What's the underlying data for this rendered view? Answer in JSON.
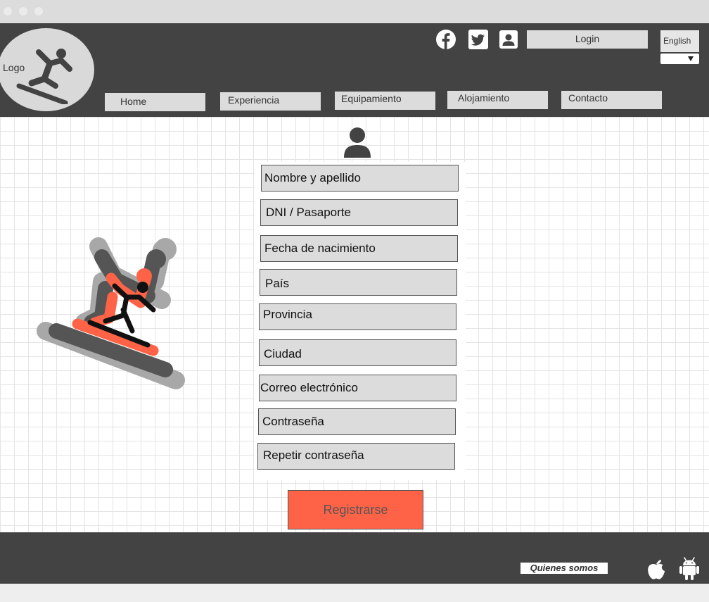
{
  "header": {
    "logo_label": "Logo",
    "login_label": "Login",
    "language": {
      "selected": "English"
    },
    "social_icons": [
      "facebook-icon",
      "twitter-icon",
      "contact-icon"
    ]
  },
  "nav": {
    "items": [
      {
        "label": "Home"
      },
      {
        "label": "Experiencia"
      },
      {
        "label": "Equipamiento"
      },
      {
        "label": "Alojamiento"
      },
      {
        "label": "Contacto"
      }
    ]
  },
  "form": {
    "icon": "user-icon",
    "fields": [
      {
        "placeholder": "Nombre y apellido"
      },
      {
        "placeholder": "DNI / Pasaporte"
      },
      {
        "placeholder": "Fecha de nacimiento"
      },
      {
        "placeholder": "País"
      },
      {
        "placeholder": "Provincia"
      },
      {
        "placeholder": "Ciudad"
      },
      {
        "placeholder": "Correo electrónico"
      },
      {
        "placeholder": "Contraseña"
      },
      {
        "placeholder": "Repetir contraseña"
      }
    ],
    "submit_label": "Registrarse"
  },
  "footer": {
    "about_label": "Quienes somos",
    "app_icons": [
      "apple-icon",
      "android-icon"
    ]
  },
  "colors": {
    "header_bg": "#434343",
    "accent": "#ff6347",
    "field_bg": "#dcdcdc"
  }
}
